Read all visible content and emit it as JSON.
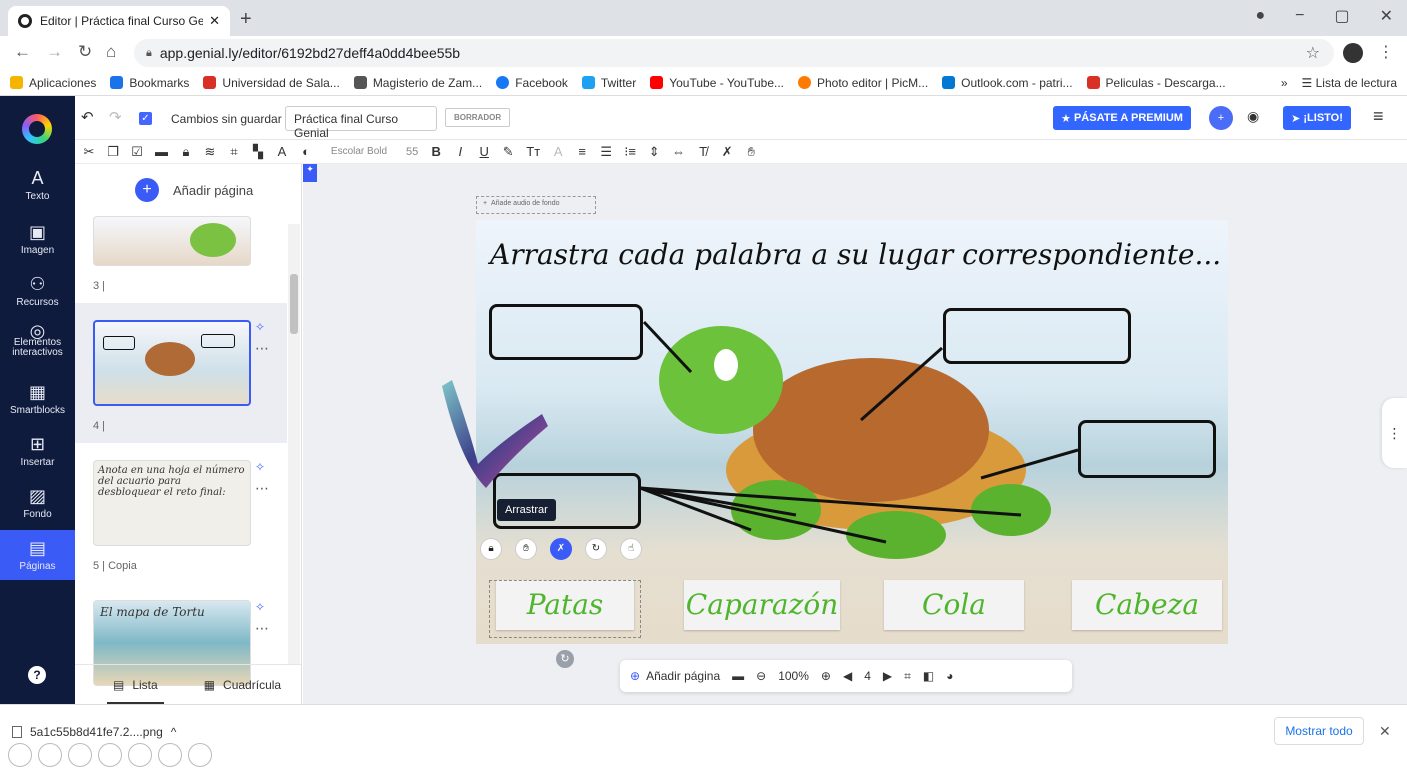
{
  "browser": {
    "tab_title": "Editor | Práctica final Curso Genia",
    "url": "app.genial.ly/editor/6192bd27deff4a0dd4bee55b",
    "bookmarks": [
      "Aplicaciones",
      "Bookmarks",
      "Universidad de Sala...",
      "Magisterio de Zam...",
      "Facebook",
      "Twitter",
      "YouTube - YouTube...",
      "Photo editor | PicM...",
      "Outlook.com - patri...",
      "Peliculas - Descarga..."
    ],
    "bookmark_colors": [
      "#f4b400",
      "#1a73e8",
      "#d93025",
      "#555555",
      "#1877f2",
      "#222222",
      "#1da1f2",
      "#ff0000",
      "#ff7a00",
      "#0078d4",
      "#d93025"
    ],
    "more": "»",
    "reading_list": "Lista de lectura"
  },
  "app": {
    "unsaved": "Cambios sin guardar",
    "project_title": "Práctica final Curso Genial",
    "draft": "BORRADOR",
    "premium": "PÁSATE A PREMIUM",
    "ready": "¡LISTO!",
    "accent": "#3b5bf7"
  },
  "leftbar": {
    "items": [
      {
        "icon": "A",
        "label": "Texto"
      },
      {
        "icon": "▣",
        "label": "Imagen"
      },
      {
        "icon": "⚇",
        "label": "Recursos"
      },
      {
        "icon": "◎",
        "label": "Elementos interactivos"
      },
      {
        "icon": "▦",
        "label": "Smartblocks"
      },
      {
        "icon": "⊞",
        "label": "Insertar"
      },
      {
        "icon": "▨",
        "label": "Fondo"
      },
      {
        "icon": "▤",
        "label": "Páginas"
      }
    ]
  },
  "toolbar": {
    "font": "Escolar Bold",
    "size": "55"
  },
  "panel": {
    "add_page": "Añadir página",
    "pages": [
      {
        "label": "3 |"
      },
      {
        "label": "4 |"
      },
      {
        "label": "5 | Copia",
        "thumb_text": "Anota en una hoja el número del acuario para desbloquear el reto final:"
      },
      {
        "label": "",
        "thumb_text": "El mapa de Tortu"
      }
    ],
    "list_tab": "Lista",
    "grid_tab": "Cuadrícula"
  },
  "slide": {
    "audio": "Añade audio de fondo",
    "title": "Arrastra cada palabra a su lugar correspondiente...",
    "words": [
      "Patas",
      "Caparazón",
      "Cola",
      "Cabeza"
    ],
    "tooltip": "Arrastrar"
  },
  "bottombar": {
    "add_page": "Añadir página",
    "zoom": "100%",
    "page": "4"
  },
  "downloads": {
    "file": "5a1c55b8d41fe7.2....png",
    "show_all": "Mostrar todo"
  }
}
